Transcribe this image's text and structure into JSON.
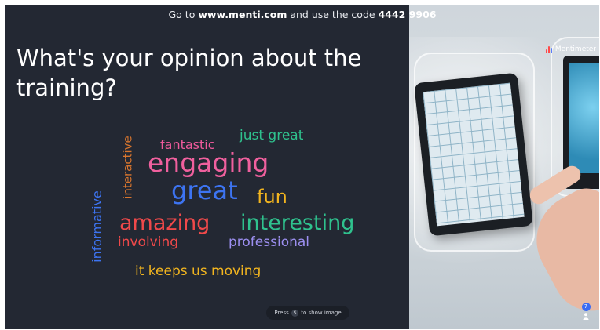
{
  "banner": {
    "prefix": "Go to ",
    "url": "www.menti.com",
    "middle": " and use the code ",
    "code": "4442 9906"
  },
  "question": "What's your opinion about the training?",
  "word_cloud": [
    {
      "text": "just great",
      "color": "#2fc28e"
    },
    {
      "text": "fantastic",
      "color": "#f05a9c"
    },
    {
      "text": "engaging",
      "color": "#f0609e"
    },
    {
      "text": "interactive",
      "color": "#d7752e"
    },
    {
      "text": "great",
      "color": "#3d74f2"
    },
    {
      "text": "fun",
      "color": "#f2b51f"
    },
    {
      "text": "informative",
      "color": "#3d74f2"
    },
    {
      "text": "amazing",
      "color": "#f0494a"
    },
    {
      "text": "interesting",
      "color": "#2fc28e"
    },
    {
      "text": "involving",
      "color": "#f0494a"
    },
    {
      "text": "professional",
      "color": "#9c8ff0"
    },
    {
      "text": "it keeps us moving",
      "color": "#f2b51f"
    }
  ],
  "brand": {
    "name": "Mentimeter",
    "icon": "mentimeter-logo-icon"
  },
  "hint": {
    "prefix": "Press",
    "key": "S",
    "suffix": "to show image"
  },
  "audience": {
    "count": "7",
    "icon": "person-icon"
  }
}
